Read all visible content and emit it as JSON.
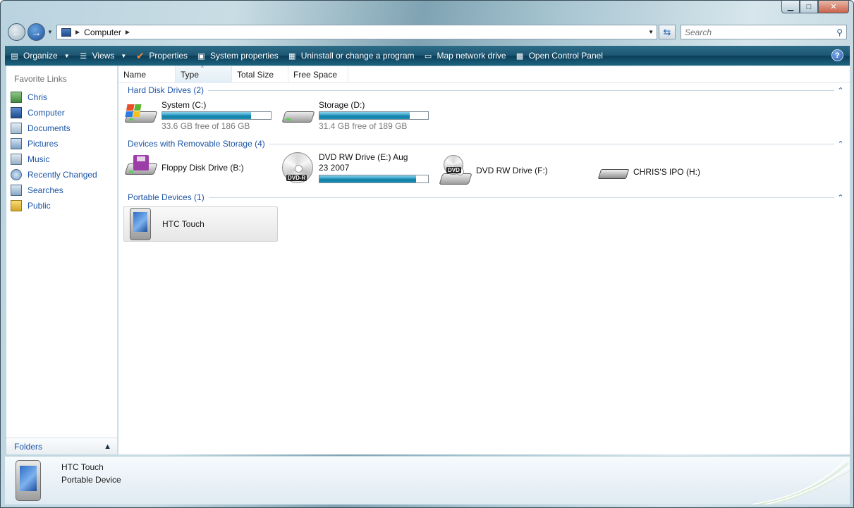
{
  "window": {
    "caption_buttons": [
      "minimize",
      "maximize",
      "close"
    ]
  },
  "address": {
    "path": "Computer",
    "search_placeholder": "Search"
  },
  "toolbar": {
    "items": [
      {
        "label": "Organize",
        "icon": "organize-icon",
        "dropdown": true
      },
      {
        "label": "Views",
        "icon": "views-icon",
        "dropdown": true
      },
      {
        "label": "Properties",
        "icon": "properties-checkmark-icon"
      },
      {
        "label": "System properties",
        "icon": "system-properties-icon"
      },
      {
        "label": "Uninstall or change a program",
        "icon": "uninstall-icon"
      },
      {
        "label": "Map network drive",
        "icon": "network-drive-icon"
      },
      {
        "label": "Open Control Panel",
        "icon": "control-panel-icon"
      }
    ]
  },
  "nav": {
    "heading": "Favorite Links",
    "items": [
      {
        "label": "Chris",
        "icon": "user-folder-icon"
      },
      {
        "label": "Computer",
        "icon": "computer-icon"
      },
      {
        "label": "Documents",
        "icon": "documents-icon"
      },
      {
        "label": "Pictures",
        "icon": "pictures-icon"
      },
      {
        "label": "Music",
        "icon": "music-icon"
      },
      {
        "label": "Recently Changed",
        "icon": "recently-changed-icon"
      },
      {
        "label": "Searches",
        "icon": "searches-icon"
      },
      {
        "label": "Public",
        "icon": "public-folder-icon"
      }
    ],
    "folders_label": "Folders"
  },
  "columns": [
    "Name",
    "Type",
    "Total Size",
    "Free Space"
  ],
  "groups": {
    "hard_disks": "Hard Disk Drives (2)",
    "removable": "Devices with Removable Storage (4)",
    "portable": "Portable Devices (1)"
  },
  "drives": {
    "system": {
      "name": "System (C:)",
      "free": "33.6 GB free of 186 GB",
      "used_fraction": 0.82
    },
    "storage": {
      "name": "Storage (D:)",
      "free": "31.4 GB free of 189 GB",
      "used_fraction": 0.83
    },
    "floppy": {
      "name": "Floppy Disk Drive (B:)"
    },
    "dvd_e": {
      "name": "DVD RW Drive (E:) Aug 23 2007",
      "used_fraction": 0.89,
      "badge": "DVD-R"
    },
    "dvd_f": {
      "name": "DVD RW Drive (F:)",
      "badge": "DVD"
    },
    "ipod": {
      "name": "CHRIS'S IPO (H:)"
    }
  },
  "portable_devices": [
    {
      "name": "HTC Touch"
    }
  ],
  "details": {
    "name": "HTC Touch",
    "type": "Portable Device"
  }
}
